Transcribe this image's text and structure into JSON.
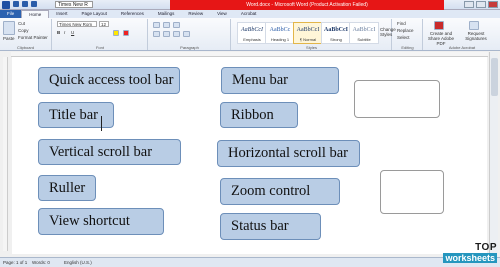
{
  "window": {
    "font_box": "Times New R",
    "title": "Word.docx - Microsoft Word (Product Activation Failed)"
  },
  "tabs": [
    "File",
    "Home",
    "Insert",
    "Page Layout",
    "References",
    "Mailings",
    "Review",
    "View",
    "Acrobat"
  ],
  "ribbon": {
    "clipboard": {
      "paste": "Paste",
      "cut": "Cut",
      "copy": "Copy",
      "format_painter": "Format Painter",
      "label": "Clipboard"
    },
    "font": {
      "name": "Times New Rom",
      "size": "12",
      "label": "Font"
    },
    "paragraph": {
      "label": "Paragraph"
    },
    "styles": {
      "items": [
        {
          "sample": "AaBbCcI",
          "name": "Emphasis"
        },
        {
          "sample": "AaBbCc",
          "name": "Heading 1"
        },
        {
          "sample": "AaBbCcI",
          "name": "¶ Normal"
        },
        {
          "sample": "AaBbCcI",
          "name": "Strong"
        },
        {
          "sample": "AaBbCcI",
          "name": "Subtitle"
        }
      ],
      "change_styles": "Change Styles",
      "label": "Styles"
    },
    "editing": {
      "find": "Find",
      "replace": "Replace",
      "select": "Select",
      "label": "Editing"
    },
    "acrobat": {
      "create_pdf": "Create and Share Adobe PDF",
      "request_signatures": "Request Signatures",
      "label": "Adobe Acrobat"
    }
  },
  "cards": {
    "quick_access": "Quick access tool bar",
    "menu_bar": "Menu bar",
    "title_bar": "Title bar",
    "ribbon": "Ribbon",
    "vertical_scroll": "Vertical scroll bar",
    "horizontal_scroll": "Horizontal scroll bar",
    "ruller": "Ruller",
    "zoom": "Zoom control",
    "view_shortcut": "View shortcut",
    "status_bar": "Status bar"
  },
  "status": {
    "page": "Page: 1 of 1",
    "words": "Words: 0",
    "language": "English (U.S.)"
  },
  "watermark": {
    "top": "TOP",
    "bottom": "worksheets"
  }
}
